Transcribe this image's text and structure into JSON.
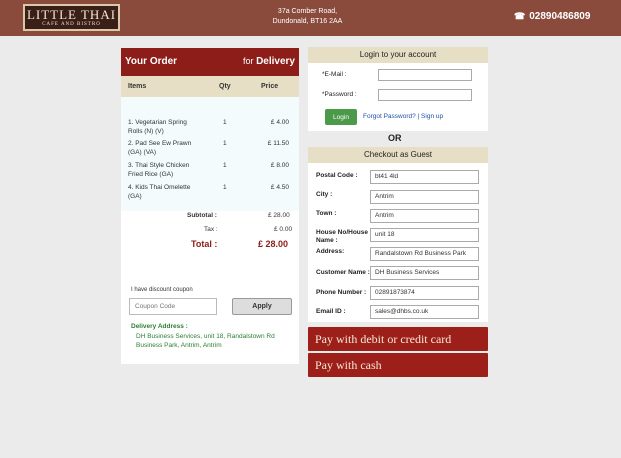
{
  "header": {
    "logo_line1": "LITTLE THAI",
    "logo_line2": "CAFE AND BISTRO",
    "address_line1": "37a Comber Road,",
    "address_line2": "Dundonald, BT16 2AA",
    "phone": "02890486809",
    "phone_icon": "☎"
  },
  "order": {
    "title": "Your Order",
    "for_label": "for",
    "mode": "Delivery",
    "columns": {
      "items": "Items",
      "qty": "Qty",
      "price": "Price"
    },
    "items": [
      {
        "name": "1. Vegetarian Spring Rolls (N) (V)",
        "qty": "1",
        "price": "£ 4.00"
      },
      {
        "name": "2. Pad See Ew Prawn (GA) (VA)",
        "qty": "1",
        "price": "£ 11.50"
      },
      {
        "name": "3. Thai Style Chicken Fried Rice (GA)",
        "qty": "1",
        "price": "£ 8.00"
      },
      {
        "name": "4. Kids Thai Omelette (GA)",
        "qty": "1",
        "price": "£ 4.50"
      }
    ],
    "subtotal_label": "Subtotal :",
    "subtotal": "£ 28.00",
    "tax_label": "Tax :",
    "tax": "£ 0.00",
    "total_label": "Total :",
    "total": "£ 28.00",
    "discount_label": "I have discount coupon",
    "coupon_placeholder": "Coupon Code",
    "apply_label": "Apply",
    "delivery_title": "Delivery Address :",
    "delivery_address": "DH Business Services, unit 18, Randalstown Rd Business Park, Antrim, Antrim"
  },
  "login": {
    "title": "Login to your account",
    "email_label": "*E-Mail :",
    "password_label": "*Password :",
    "button": "Login",
    "links": "Forgot Password? | Sign up"
  },
  "or_label": "OR",
  "guest": {
    "title": "Checkout as Guest",
    "fields": [
      {
        "label": "Postal Code :",
        "value": "bt41 4ld"
      },
      {
        "label": "City :",
        "value": "Antrim"
      },
      {
        "label": "Town :",
        "value": "Antrim"
      },
      {
        "label": "House No/House Name :",
        "value": "unit 18"
      },
      {
        "label": "Address:",
        "value": "Randalstown Rd Business Park"
      },
      {
        "label": "Customer Name :",
        "value": "DH Business Services"
      },
      {
        "label": "Phone Number :",
        "value": "02891873874"
      },
      {
        "label": "Email ID :",
        "value": "sales@dhbs.co.uk"
      }
    ]
  },
  "pay": {
    "card_label": "Pay with debit or credit card",
    "cash_label": "Pay with cash"
  }
}
